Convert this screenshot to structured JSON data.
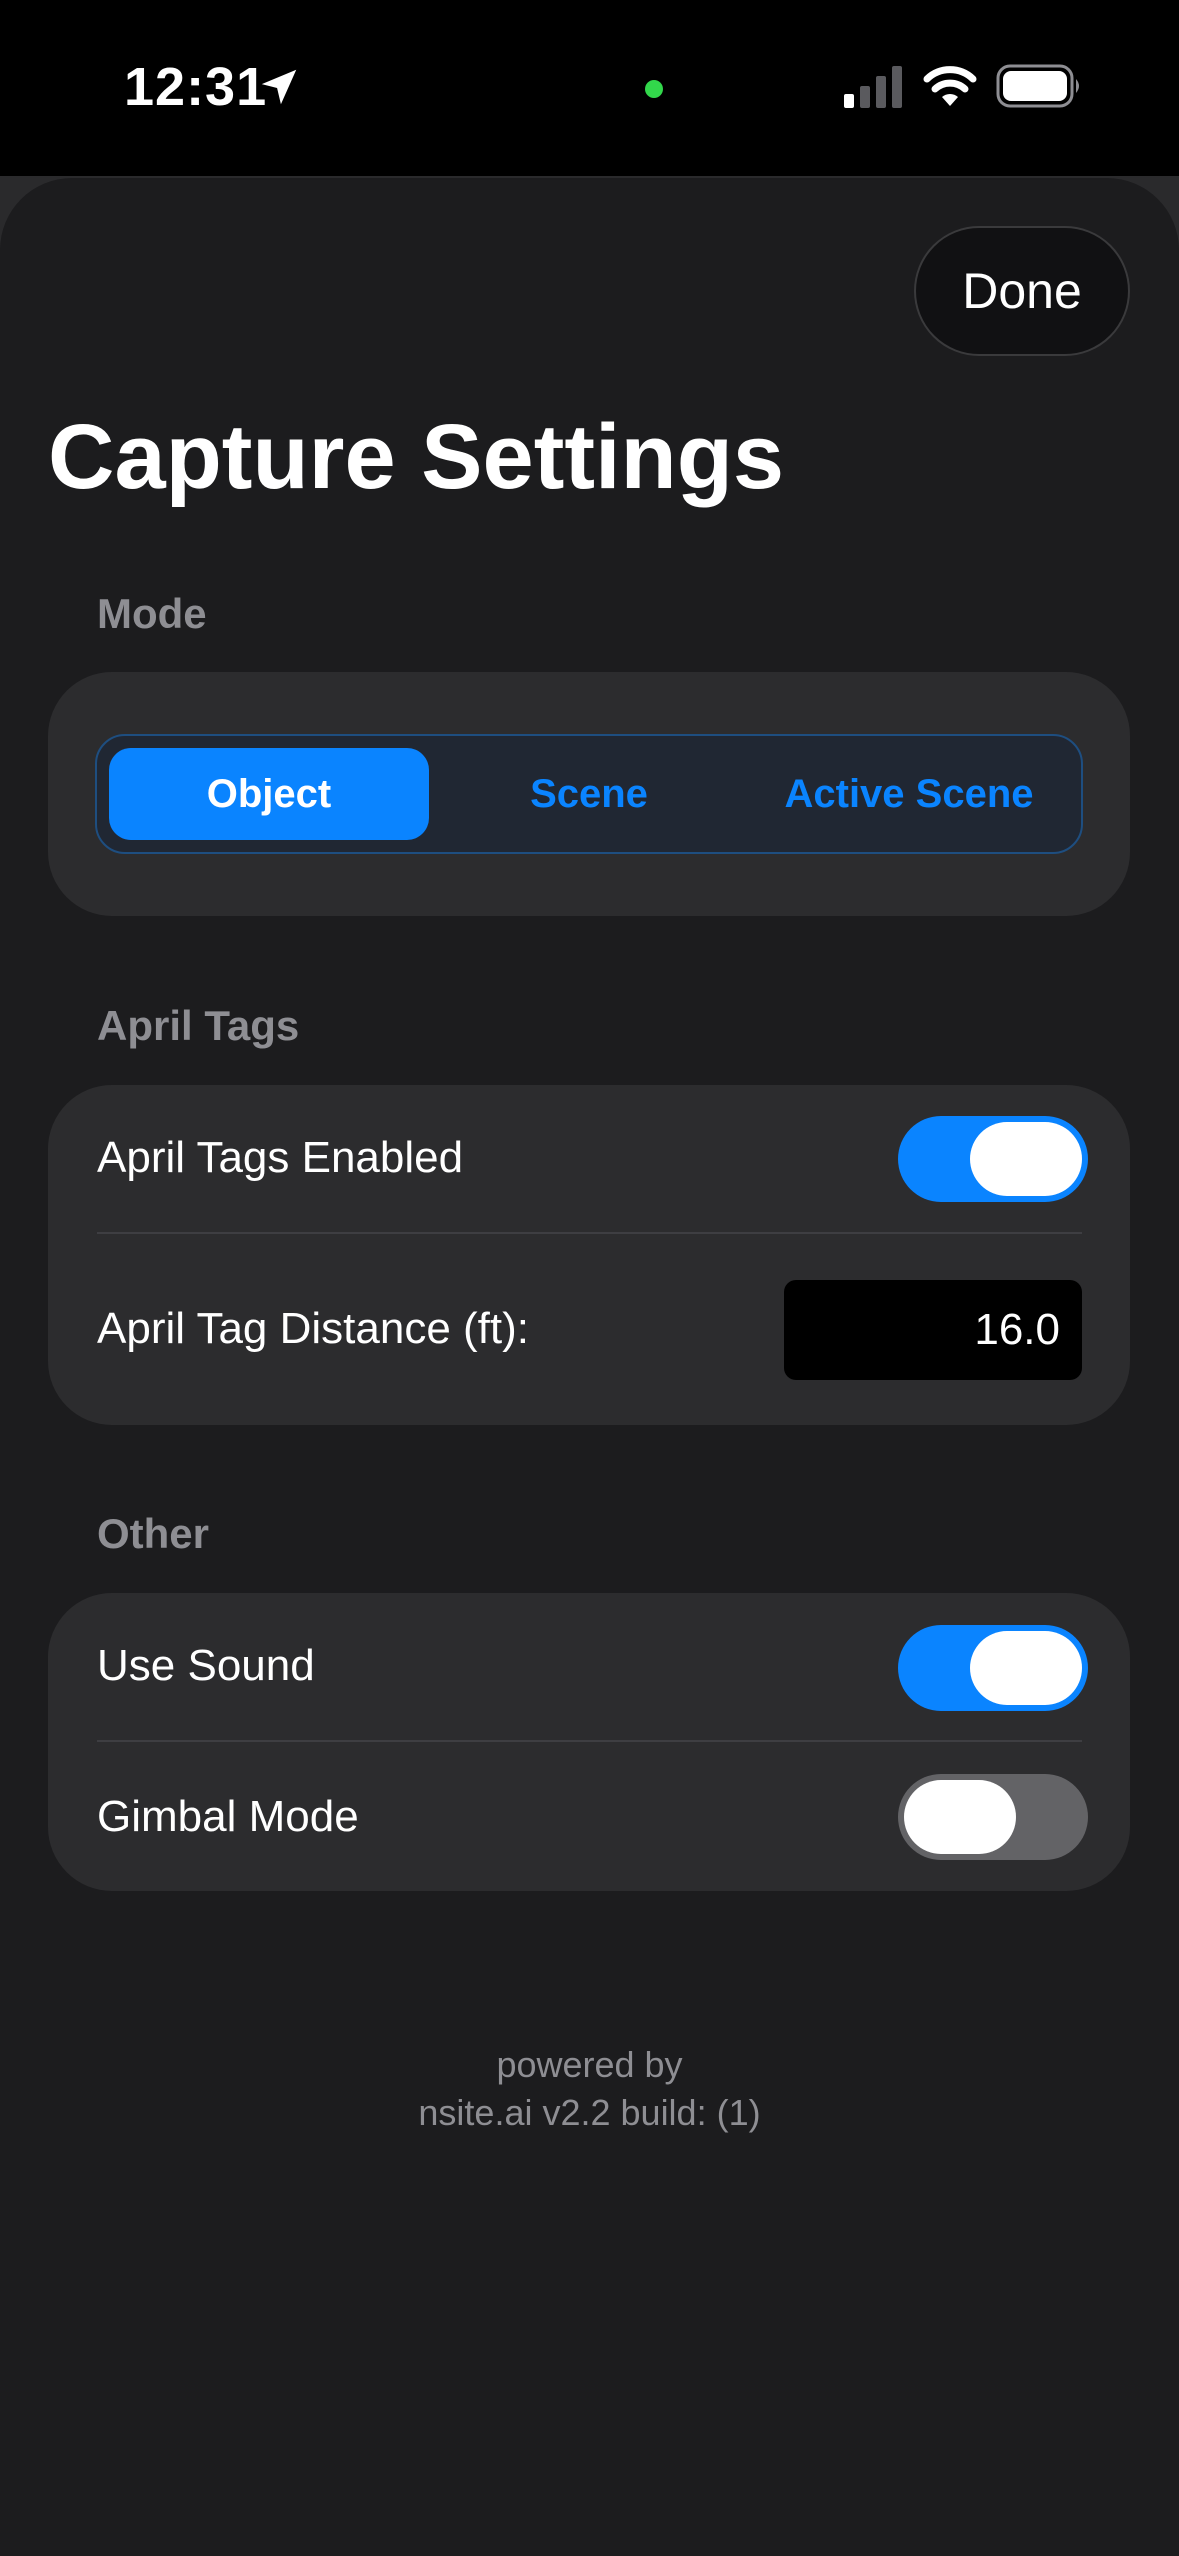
{
  "status_bar": {
    "time": "12:31"
  },
  "header": {
    "done_label": "Done",
    "title": "Capture Settings"
  },
  "mode_section": {
    "header": "Mode",
    "segments": [
      "Object",
      "Scene",
      "Active Scene"
    ],
    "selected": "Object"
  },
  "april_tags_section": {
    "header": "April Tags",
    "enabled_label": "April Tags Enabled",
    "enabled": true,
    "distance_label": "April Tag Distance (ft):",
    "distance_value": "16.0"
  },
  "other_section": {
    "header": "Other",
    "use_sound_label": "Use Sound",
    "use_sound": true,
    "gimbal_mode_label": "Gimbal Mode",
    "gimbal_mode": false
  },
  "footer": {
    "line1": "powered by",
    "line2": "nsite.ai v2.2 build: (1)"
  },
  "colors": {
    "accent": "#0a84ff",
    "sheet_background": "#1c1c1e",
    "card_background": "#2c2c2e",
    "secondary_text": "#8e8e93",
    "recording_indicator": "#32d74b"
  }
}
